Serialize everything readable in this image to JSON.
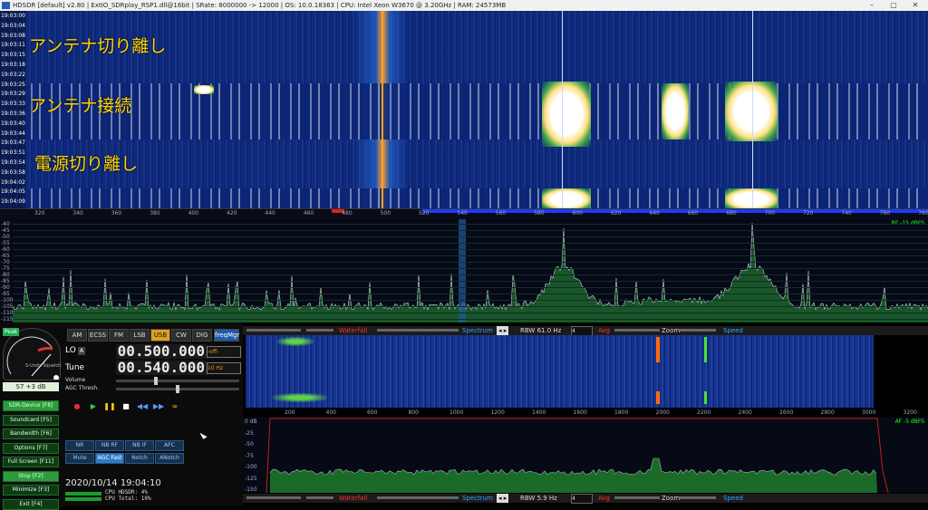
{
  "title_bar": {
    "text": "HDSDR  [default]   v2.80  |  ExtIO_SDRplay_RSP1.dll@16bit  |  SRate: 8000000 -> 12000  |  OS: 10.0.18363  |  CPU: Intel Xeon        W3670 @ 3.20GHz  |  RAM: 24573MB",
    "min": "–",
    "max": "▢",
    "close": "✕"
  },
  "waterfall_times": [
    "19:03:00",
    "19:03:04",
    "19:03:08",
    "19:03:11",
    "19:03:15",
    "19:03:18",
    "19:03:22",
    "19:03:25",
    "19:03:29",
    "19:03:33",
    "19:03:36",
    "19:03:40",
    "19:03:44",
    "19:03:47",
    "19:03:51",
    "19:03:54",
    "19:03:58",
    "19:04:02",
    "19:04:05",
    "19:04:09"
  ],
  "annotations": {
    "antenna_disconnect": "アンテナ切り離し",
    "antenna_connect": "アンテナ接続",
    "power_disconnect": "電源切り離し"
  },
  "freq_scale": [
    "320",
    "340",
    "360",
    "380",
    "400",
    "420",
    "440",
    "460",
    "480",
    "500",
    "520",
    "540",
    "560",
    "580",
    "600",
    "620",
    "640",
    "660",
    "680",
    "700",
    "720",
    "740",
    "760",
    "780"
  ],
  "spectrum": {
    "db_labels": [
      "-40",
      "-45",
      "-50",
      "-55",
      "-60",
      "-65",
      "-70",
      "-75",
      "-80",
      "-85",
      "-90",
      "-95",
      "-100",
      "-105",
      "-110",
      "-115"
    ],
    "rf_level": "RF -15 dBFS"
  },
  "left_panel": {
    "peak": "Peak",
    "squelch_label": "S-Units Squelch",
    "smeter_value": "S7 +3 dB",
    "side_buttons": [
      {
        "label": "SDR-Device [F8]",
        "active": true
      },
      {
        "label": "Soundcard [F5]",
        "active": false
      },
      {
        "label": "Bandwidth [F6]",
        "active": false
      },
      {
        "label": "Options [F7]",
        "active": false
      },
      {
        "label": "Full Screen [F11]",
        "active": false
      },
      {
        "label": "Stop [F2]",
        "active": true
      },
      {
        "label": "Minimize [F3]",
        "active": false
      },
      {
        "label": "Exit [F4]",
        "active": false
      }
    ],
    "modes": [
      "AM",
      "ECSS",
      "FM",
      "LSB",
      "USB",
      "CW",
      "DIG"
    ],
    "selected_mode": "USB",
    "freqmgr": "freqMgr",
    "lo_label": "LO",
    "lo_a": "A",
    "lo_value": "00.500.000",
    "lo_offset": "-off-",
    "tune_label": "Tune",
    "tune_value": "00.540.000",
    "tune_step": "10 Hz",
    "volume_label": "Volume",
    "agc_label": "AGC Thresh.",
    "dsp_row1": [
      "NR",
      "NB RF",
      "NB IF",
      "AFC"
    ],
    "dsp_row2": [
      "Mute",
      "AGC Fast",
      "Notch",
      "ANotch"
    ],
    "dsp_on": "AGC Fast",
    "datetime": "2020/10/14 19:04:10",
    "cpu_hdsdr": "CPU HDSDR:  4%",
    "cpu_total": "CPU Total: 10%"
  },
  "audio_panel": {
    "bar_top": {
      "waterfall": "Waterfall",
      "spectrum": "Spectrum",
      "rbw": "RBW 61.0 Hz",
      "rbw_n": "4",
      "avg": "Avg",
      "zoom": "Zoom",
      "speed": "Speed"
    },
    "af_scale": [
      "200",
      "400",
      "600",
      "800",
      "1000",
      "1200",
      "1400",
      "1600",
      "1800",
      "2000",
      "2200",
      "2400",
      "2600",
      "2800",
      "3000",
      "3200"
    ],
    "af_db": [
      "0 dB",
      "-25",
      "-50",
      "-75",
      "-100",
      "-125",
      "-150"
    ],
    "af_level": "AF -5 dBFS",
    "bar_bottom": {
      "waterfall": "Waterfall",
      "spectrum": "Spectrum",
      "rbw": "RBW 5.9 Hz",
      "rbw_n": "4",
      "avg": "Avg",
      "zoom": "Zoom",
      "speed": "Speed"
    }
  },
  "colors": {
    "waterfall_bg": "#0a1f6a",
    "carrier": "#ff9f28",
    "annotation": "#ffd400",
    "spectrum_fill": "#2e9a3a",
    "green_btn": "#2b9d3a"
  }
}
